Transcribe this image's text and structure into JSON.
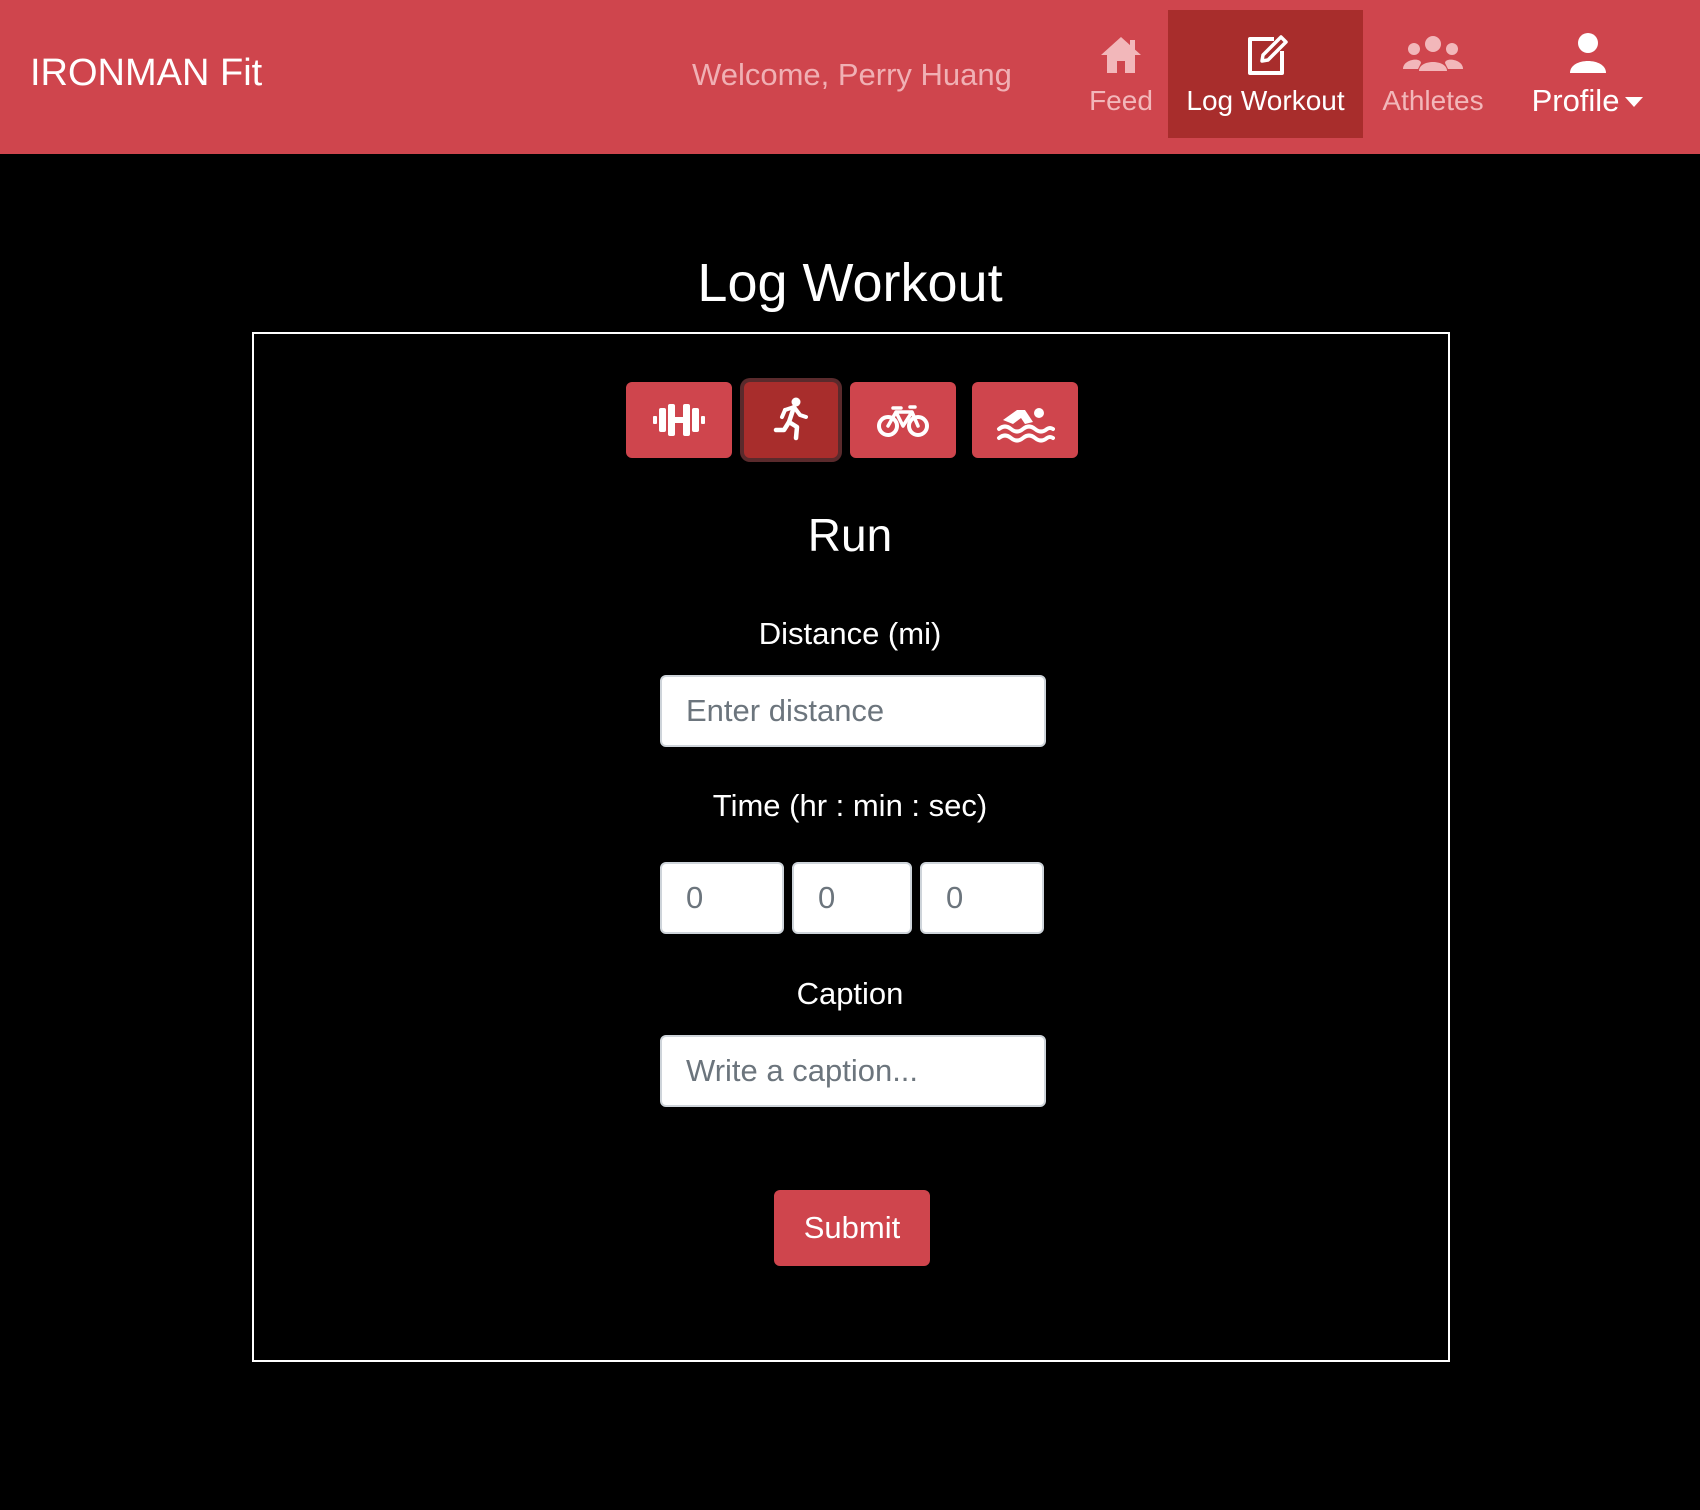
{
  "navbar": {
    "brand": "IRONMAN Fit",
    "welcome": "Welcome, Perry Huang",
    "items": [
      {
        "label": "Feed",
        "icon": "house-icon"
      },
      {
        "label": "Log Workout",
        "icon": "edit-icon",
        "active": true
      },
      {
        "label": "Athletes",
        "icon": "users-icon"
      },
      {
        "label": "Profile",
        "icon": "user-icon",
        "dropdown": true
      }
    ]
  },
  "page": {
    "title": "Log Workout"
  },
  "workout_types": [
    {
      "name": "weights",
      "icon": "dumbbell-icon"
    },
    {
      "name": "run",
      "icon": "running-icon",
      "selected": true
    },
    {
      "name": "bike",
      "icon": "bicycle-icon"
    },
    {
      "name": "swim",
      "icon": "swimmer-icon"
    }
  ],
  "form": {
    "workout_name": "Run",
    "distance_label": "Distance (mi)",
    "distance_placeholder": "Enter distance",
    "distance_value": "",
    "time_label": "Time (hr : min : sec)",
    "time_hr_placeholder": "0",
    "time_min_placeholder": "0",
    "time_sec_placeholder": "0",
    "caption_label": "Caption",
    "caption_placeholder": "Write a caption...",
    "caption_value": "",
    "submit_label": "Submit"
  },
  "colors": {
    "navbar": "#cf454d",
    "active_nav": "#a82d2c",
    "background": "#000000",
    "button": "#cf454d"
  }
}
